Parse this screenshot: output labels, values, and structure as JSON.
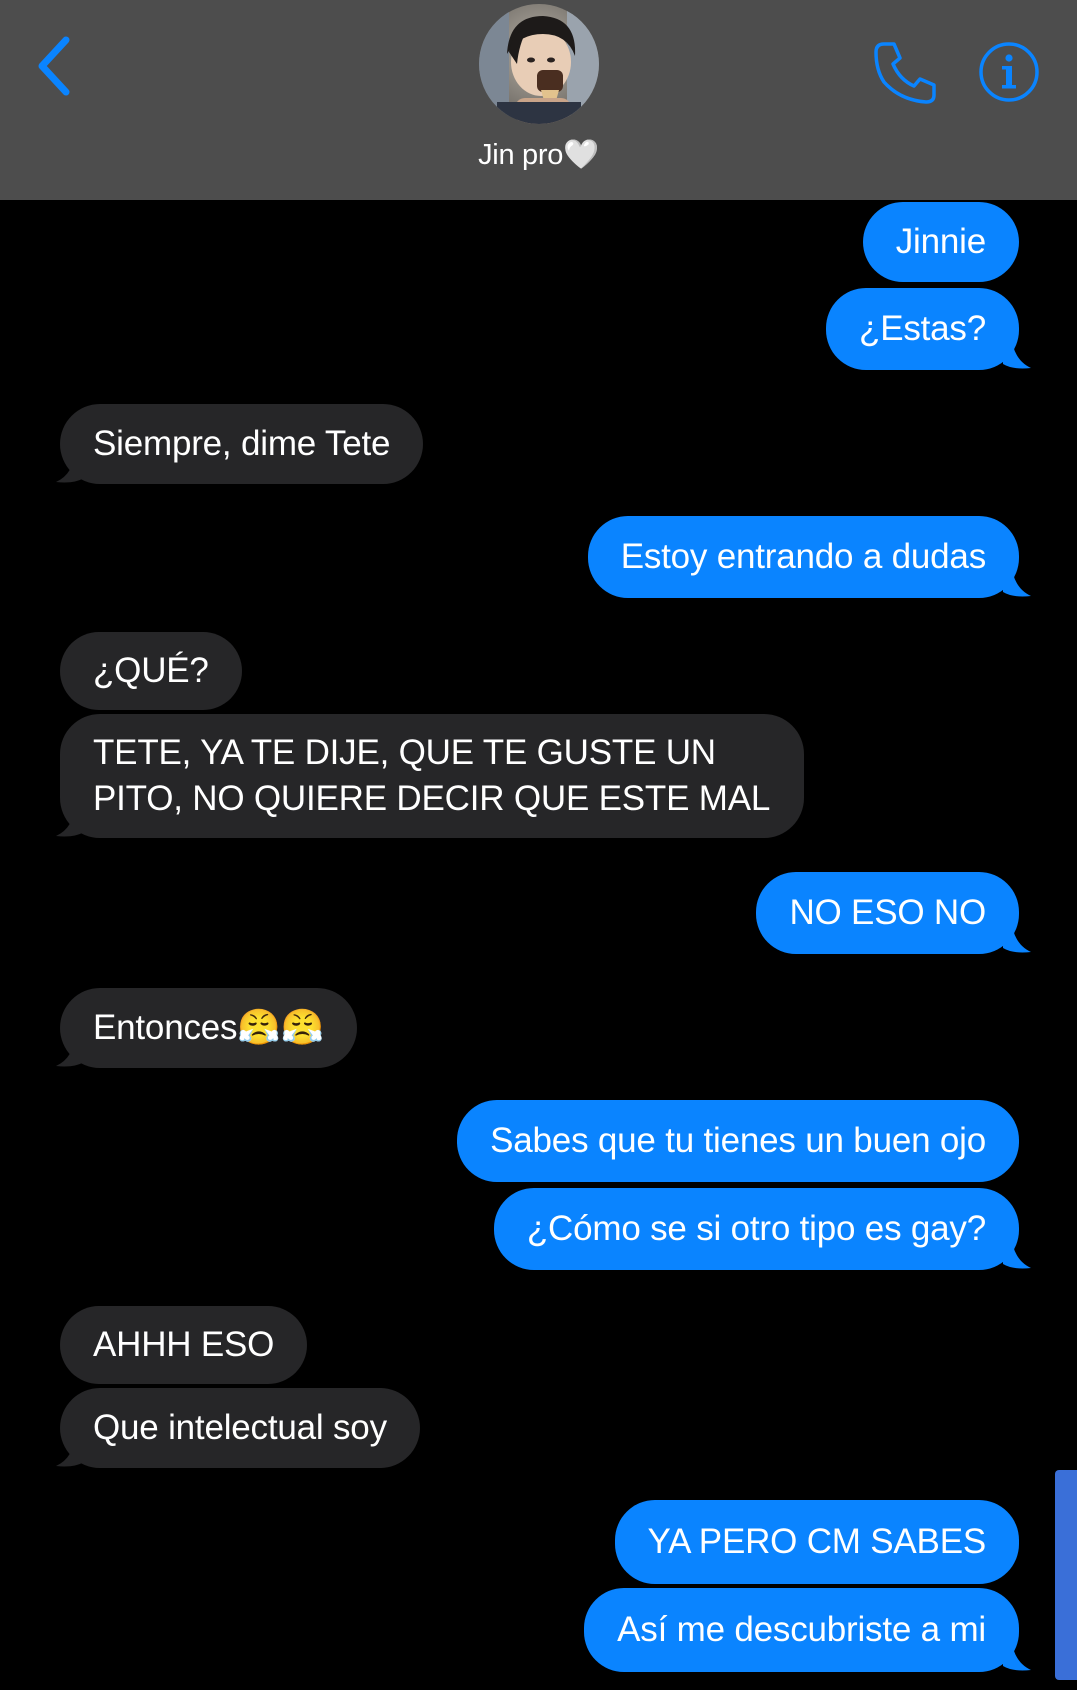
{
  "header": {
    "contact_name": "Jin pro",
    "contact_emoji": "🤍",
    "back_icon": "chevron-left-icon",
    "call_icon": "phone-icon",
    "info_icon": "info-icon",
    "accent_color": "#0a84ff",
    "header_bg": "#4d4d4d"
  },
  "messages": [
    {
      "dir": "out",
      "text": "Jinnie"
    },
    {
      "dir": "out",
      "text": "¿Estas?"
    },
    {
      "dir": "in",
      "text": "Siempre, dime Tete"
    },
    {
      "dir": "out",
      "text": "Estoy entrando a dudas"
    },
    {
      "dir": "in",
      "text": "¿QUÉ?"
    },
    {
      "dir": "in",
      "text": "TETE, YA TE DIJE, QUE TE GUSTE UN PITO, NO QUIERE DECIR QUE ESTE MAL"
    },
    {
      "dir": "out",
      "text": "NO ESO NO"
    },
    {
      "dir": "in",
      "text": "Entonces😤😤"
    },
    {
      "dir": "out",
      "text": "Sabes que tu tienes un buen ojo"
    },
    {
      "dir": "out",
      "text": "¿Cómo se si otro tipo es gay?"
    },
    {
      "dir": "in",
      "text": "AHHH ESO"
    },
    {
      "dir": "in",
      "text": "Que intelectual soy"
    },
    {
      "dir": "out",
      "text": "YA PERO CM SABES"
    },
    {
      "dir": "out",
      "text": "Así me descubriste a mi"
    }
  ],
  "colors": {
    "outgoing_bubble": "#0a84ff",
    "incoming_bubble": "#262628",
    "background": "#000000"
  }
}
